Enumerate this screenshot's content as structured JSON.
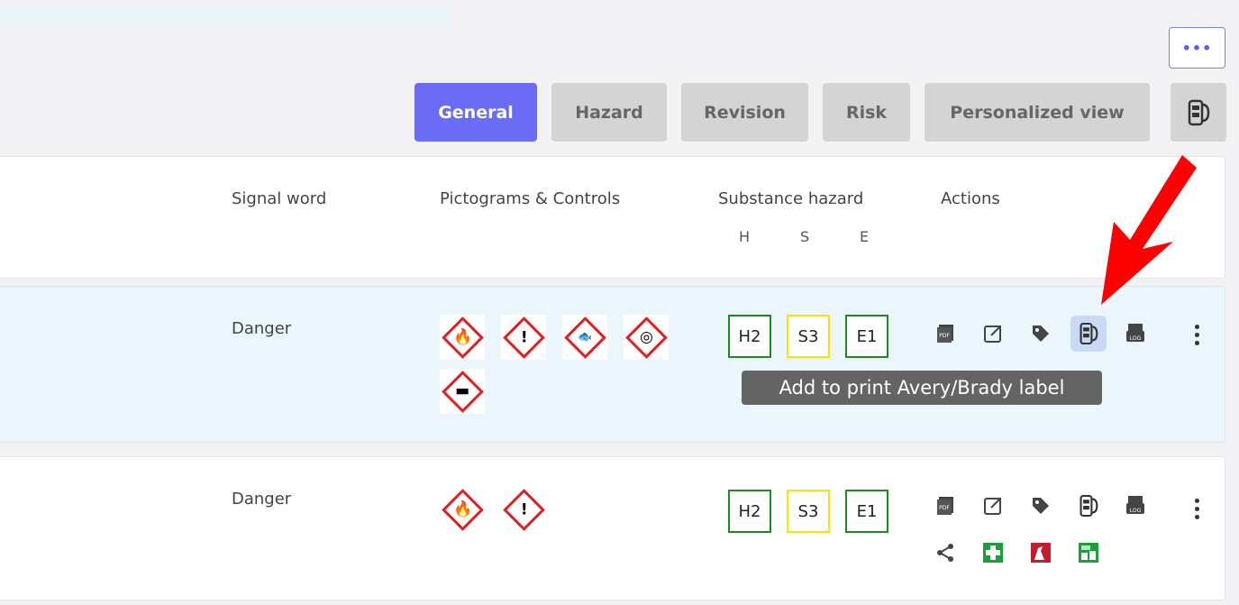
{
  "more_button_label": "•••",
  "tabs": [
    {
      "label": "General",
      "active": true
    },
    {
      "label": "Hazard",
      "active": false
    },
    {
      "label": "Revision",
      "active": false
    },
    {
      "label": "Risk",
      "active": false
    },
    {
      "label": "Personalized view",
      "active": false
    }
  ],
  "table_header": {
    "signal_word": "Signal word",
    "pictograms": "Pictograms & Controls",
    "substance_hazard": "Substance hazard",
    "hse": [
      "H",
      "S",
      "E"
    ],
    "actions": "Actions"
  },
  "rows": [
    {
      "signal": "Danger",
      "pictograms": [
        "flame-pictogram",
        "exclamation-pictogram",
        "environment-pictogram",
        "oxidizer-pictogram",
        "gas-cylinder-pictogram"
      ],
      "hazard": [
        "H2",
        "S3",
        "E1"
      ]
    },
    {
      "signal": "Danger",
      "pictograms": [
        "flame-pictogram",
        "exclamation-pictogram"
      ],
      "hazard": [
        "H2",
        "S3",
        "E1"
      ]
    }
  ],
  "tooltip": "Add to print Avery/Brady label",
  "colors": {
    "accent": "#6a6cf6",
    "tab_inactive": "#d4d4d4",
    "row_selected": "#eaf6fc",
    "hazard_green": "#1e8a1e",
    "hazard_yellow": "#f4e600",
    "pictogram_red": "#e02020",
    "annotation_arrow": "#ff0000"
  }
}
